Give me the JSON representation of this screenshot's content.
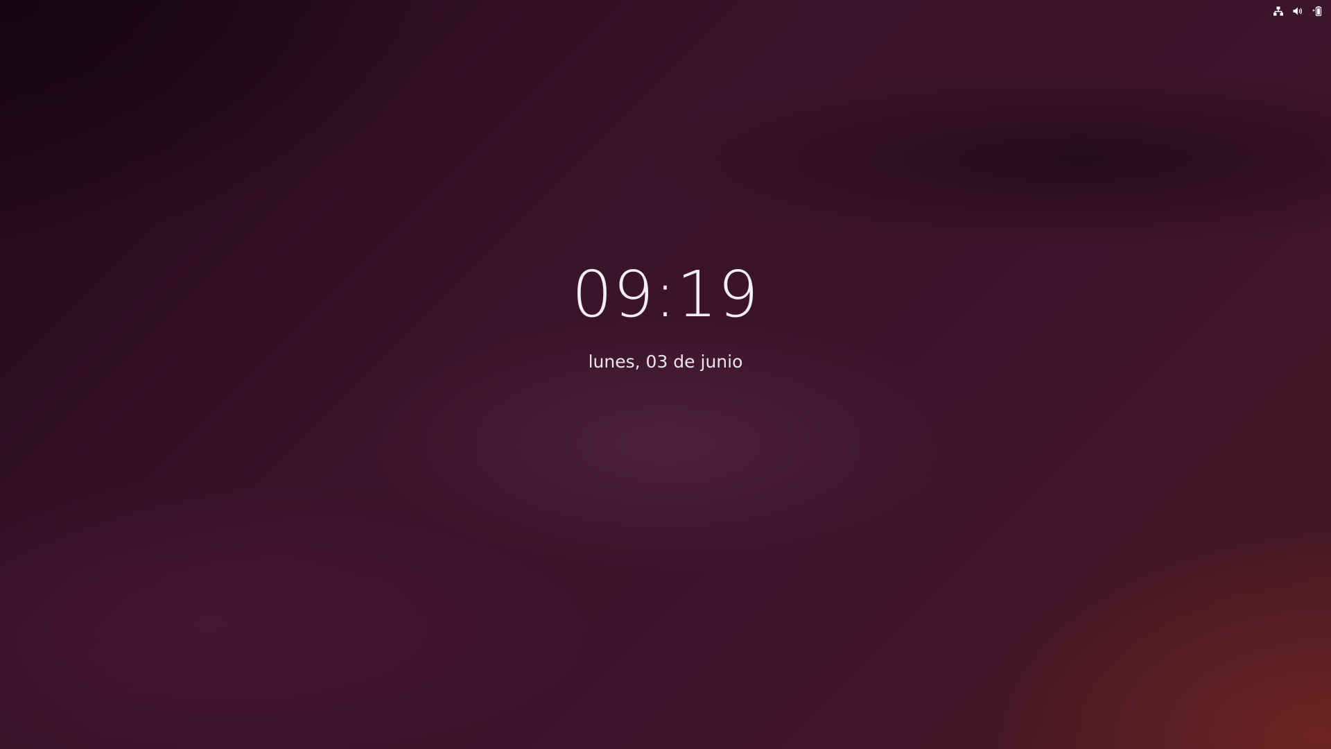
{
  "top_bar": {
    "tray_icons": [
      {
        "icon": "network-wired-icon"
      },
      {
        "icon": "volume-icon"
      },
      {
        "icon": "battery-icon"
      }
    ]
  },
  "lock_screen": {
    "time": "09:19",
    "date": "lunes, 03 de junio"
  },
  "colors": {
    "background_base": "#351226",
    "text": "#f2eef1"
  }
}
